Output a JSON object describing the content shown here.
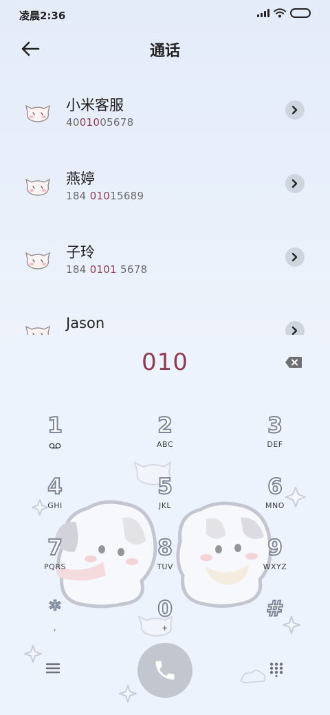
{
  "status_bar": {
    "time": "凌晨2:36"
  },
  "header": {
    "title": "通话",
    "back_icon": "arrow-left-icon"
  },
  "contacts": [
    {
      "name": "小米客服",
      "number_pre": "40",
      "number_hl": "010",
      "number_post": "05678"
    },
    {
      "name": "燕婷",
      "number_pre": "184 ",
      "number_hl": "010",
      "number_post": "15689"
    },
    {
      "name": "子玲",
      "number_pre": "184 ",
      "number_hl": "0101",
      "number_post": " 5678"
    },
    {
      "name": "Jason",
      "number_pre": "",
      "number_hl": "",
      "number_post": ""
    }
  ],
  "dialer": {
    "input": "010",
    "keys": [
      {
        "digit": "1",
        "letters": ""
      },
      {
        "digit": "2",
        "letters": "ABC"
      },
      {
        "digit": "3",
        "letters": "DEF"
      },
      {
        "digit": "4",
        "letters": "GHI"
      },
      {
        "digit": "5",
        "letters": "JKL"
      },
      {
        "digit": "6",
        "letters": "MNO"
      },
      {
        "digit": "7",
        "letters": "PQRS"
      },
      {
        "digit": "8",
        "letters": "TUV"
      },
      {
        "digit": "9",
        "letters": "WXYZ"
      },
      {
        "digit": "*",
        "letters": ","
      },
      {
        "digit": "0",
        "letters": "+"
      },
      {
        "digit": "#",
        "letters": ""
      }
    ]
  },
  "colors": {
    "highlight": "#8e3b52",
    "background": "#e6eef9",
    "call_button": "#c2c7cf"
  }
}
